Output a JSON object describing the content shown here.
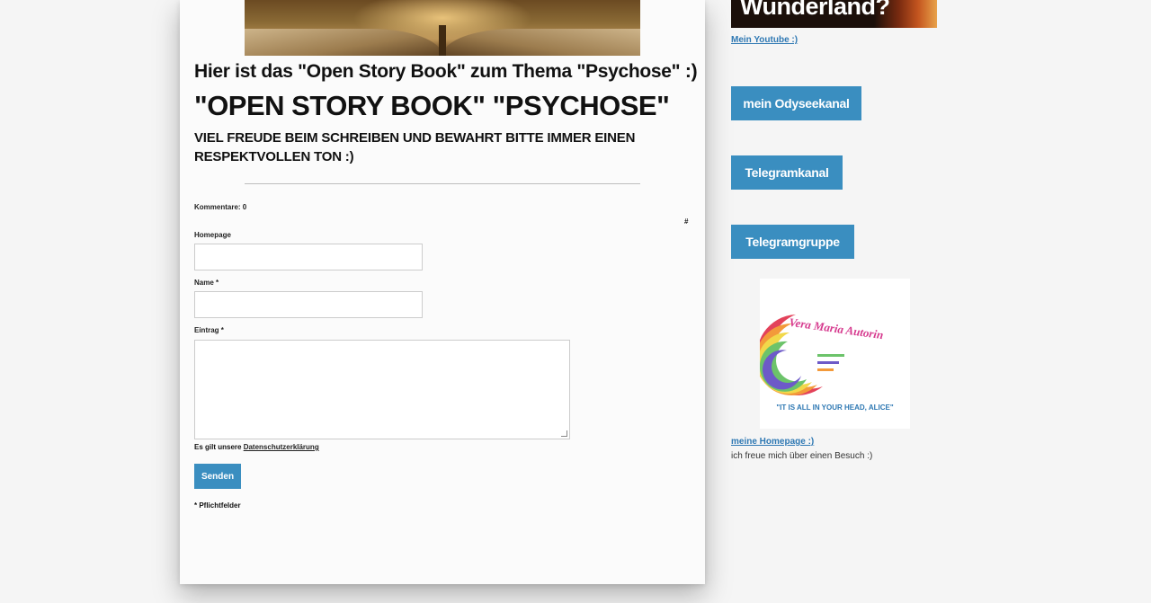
{
  "main": {
    "intro": "Hier ist das \"Open Story Book\" zum Thema \"Psychose\" :)",
    "title": "\"OPEN STORY BOOK\" \"PSYCHOSE\"",
    "subtitle": "VIEL FREUDE BEIM SCHREIBEN UND BEWAHRT BITTE IMMER EINEN RESPEKTVOLLEN TON :)"
  },
  "form": {
    "comments_label": "Kommentare: 0",
    "hash_link": "#",
    "homepage_label": "Homepage",
    "homepage_value": "",
    "name_label": "Name *",
    "name_value": "",
    "entry_label": "Eintrag *",
    "entry_value": "",
    "consent_prefix": "Es gilt unsere ",
    "consent_link": "Datenschutzerklärung",
    "send_label": "Senden",
    "required_note": "* Pflichtfelder"
  },
  "sidebar": {
    "banner_text": "Wunderland?",
    "youtube_link": "Mein Youtube :)",
    "buttons": [
      "mein Odyseekanal",
      "Telegramkanal",
      "Telegramgruppe"
    ],
    "logo_text": "Vera Maria Autorin",
    "logo_tagline": "\"IT IS ALL IN YOUR HEAD, ALICE\"",
    "homepage_link": "meine Homepage :)",
    "homepage_note": "ich freue mich über einen Besuch :)"
  },
  "colors": {
    "accent": "#3a8ec0",
    "link": "#2e78b3",
    "background": "#f5f5f5",
    "card": "#fbfbfb"
  }
}
